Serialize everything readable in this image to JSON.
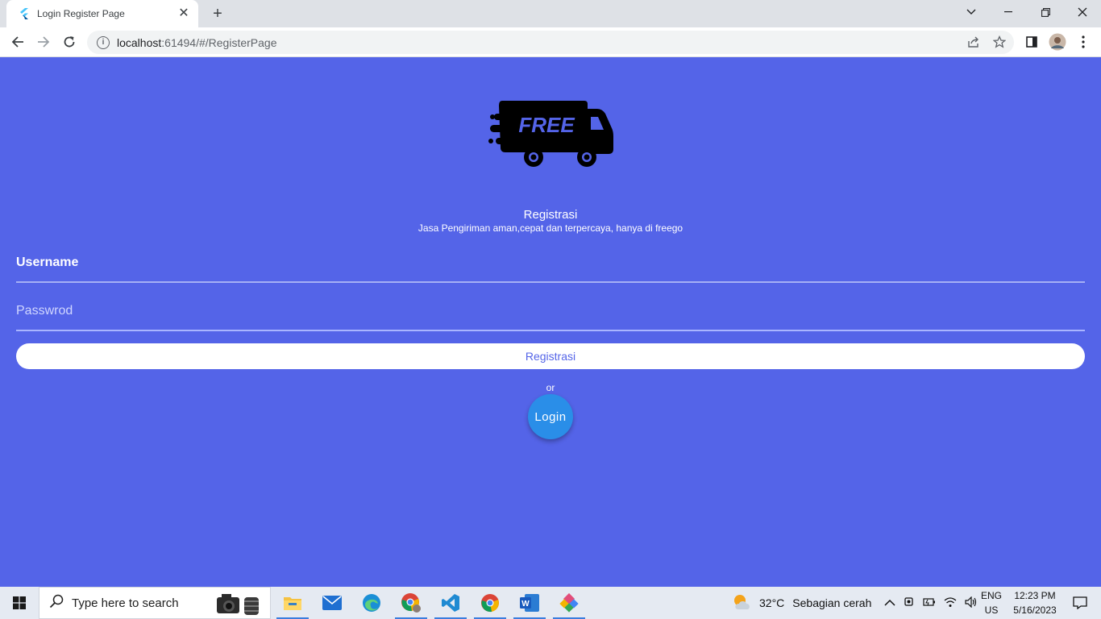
{
  "browser": {
    "tab_title": "Login Register Page",
    "url_host": "localhost",
    "url_path": ":61494/#/RegisterPage"
  },
  "page": {
    "title": "Registrasi",
    "subtitle": "Jasa Pengiriman aman,cepat dan terpercaya, hanya di freego",
    "logo_text": "FREE",
    "username_label": "Username",
    "password_label": "Passwrod",
    "register_button": "Registrasi",
    "or_text": "or",
    "login_button": "Login"
  },
  "taskbar": {
    "search_placeholder": "Type here to search",
    "weather_temp": "32°C",
    "weather_desc": "Sebagian cerah",
    "lang_primary": "ENG",
    "lang_secondary": "US",
    "time": "12:23 PM",
    "date": "5/16/2023"
  },
  "colors": {
    "page_bg": "#5464e8",
    "login_button": "#2a8ee8",
    "register_text": "#5464e8"
  }
}
